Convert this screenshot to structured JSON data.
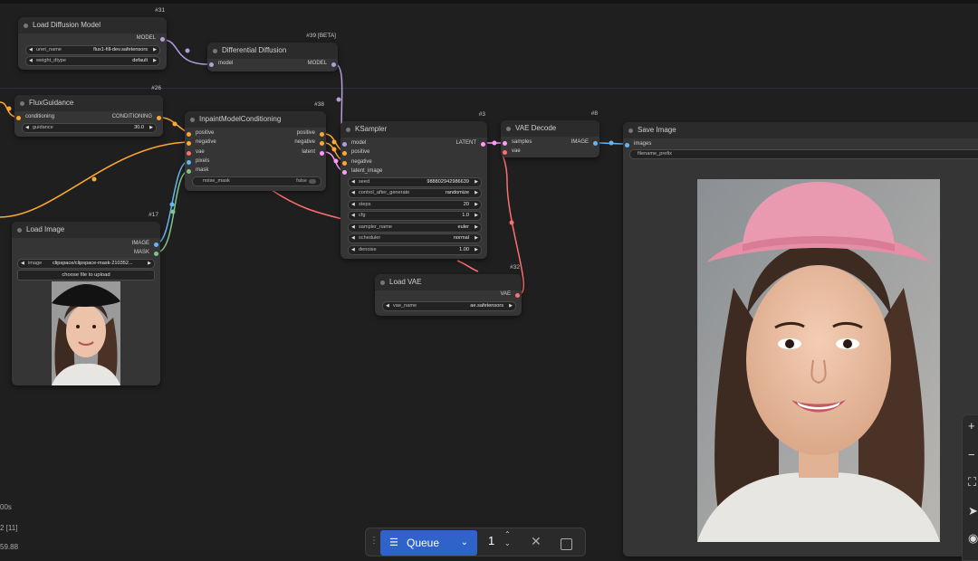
{
  "nodes": {
    "load_diffusion_model": {
      "title": "Load Diffusion Model",
      "id": "#31",
      "output": "MODEL",
      "widgets": [
        {
          "label": "unet_name",
          "value": "flux1-fill-dev.safetensors"
        },
        {
          "label": "weight_dtype",
          "value": "default"
        }
      ]
    },
    "differential_diffusion": {
      "title": "Differential Diffusion",
      "id": "#39 [BETA]",
      "input": "model",
      "output": "MODEL"
    },
    "flux_guidance": {
      "title": "FluxGuidance",
      "id": "#26",
      "input": "conditioning",
      "output": "CONDITIONING",
      "widgets": [
        {
          "label": "guidance",
          "value": "30.0"
        }
      ]
    },
    "inpaint_model_conditioning": {
      "title": "InpaintModelConditioning",
      "id": "#38",
      "inputs": [
        "positive",
        "negative",
        "vae",
        "pixels",
        "mask"
      ],
      "outputs": [
        "positive",
        "negative",
        "latent"
      ],
      "widgets": [
        {
          "label": "noise_mask",
          "value": "false"
        }
      ]
    },
    "ksampler": {
      "title": "KSampler",
      "id": "#3",
      "inputs": [
        "model",
        "positive",
        "negative",
        "latent_image"
      ],
      "output": "LATENT",
      "widgets": [
        {
          "label": "seed",
          "value": "988802942986639"
        },
        {
          "label": "control_after_generate",
          "value": "randomize"
        },
        {
          "label": "steps",
          "value": "20"
        },
        {
          "label": "cfg",
          "value": "1.0"
        },
        {
          "label": "sampler_name",
          "value": "euler"
        },
        {
          "label": "scheduler",
          "value": "normal"
        },
        {
          "label": "denoise",
          "value": "1.00"
        }
      ]
    },
    "vae_decode": {
      "title": "VAE Decode",
      "id": "#8",
      "inputs": [
        "samples",
        "vae"
      ],
      "output": "IMAGE"
    },
    "save_image": {
      "title": "Save Image",
      "input": "images",
      "widgets": [
        {
          "label": "filename_prefix",
          "value": ""
        }
      ]
    },
    "load_image": {
      "title": "Load Image",
      "id": "#17",
      "outputs": [
        "IMAGE",
        "MASK"
      ],
      "widgets": [
        {
          "label": "image",
          "value": "clipspace/clipspace-mask-210352..."
        }
      ],
      "upload_label": "choose file to upload"
    },
    "load_vae": {
      "title": "Load VAE",
      "id": "#32",
      "output": "VAE",
      "widgets": [
        {
          "label": "vae_name",
          "value": "ae.safetensors"
        }
      ]
    }
  },
  "queue": {
    "label": "Queue",
    "count": "1"
  },
  "stats": [
    "00s",
    "2 [11]",
    "59.88"
  ],
  "colors": {
    "model": "#b39ddb",
    "conditioning": "#ffa931",
    "latent": "#ff9cf9",
    "image": "#64b5f6",
    "mask": "#81c784",
    "vae": "#ff6e6e",
    "accent": "#2f63c9"
  },
  "icons": {
    "queue": "list-play-icon",
    "chevron": "chevron-down-icon",
    "cancel": "close-icon",
    "stop": "stop-square-icon",
    "zoom_in": "plus-icon",
    "zoom_out": "minus-icon",
    "fit": "fit-view-icon",
    "locate": "navigate-icon",
    "visibility": "eye-icon"
  }
}
